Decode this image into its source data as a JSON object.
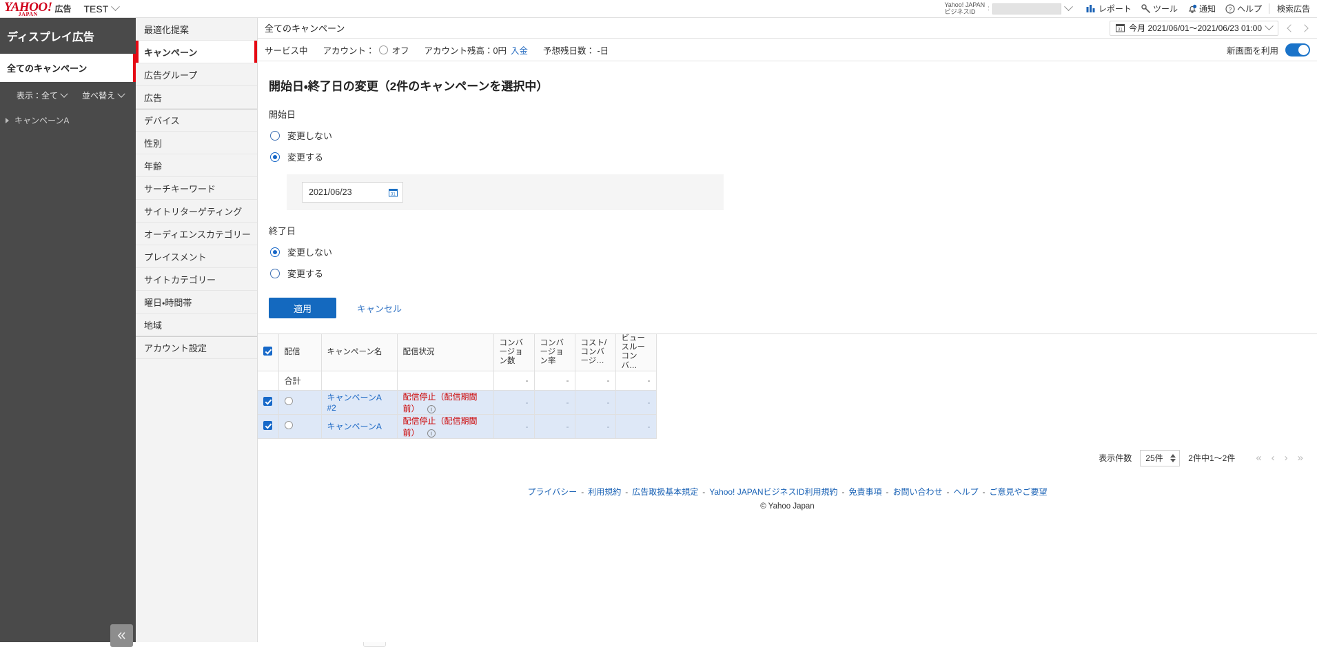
{
  "global_header": {
    "logo_main": "YAHOO!",
    "logo_sub": "JAPAN",
    "logo_suffix": "広告",
    "account_name": "TEST",
    "bizid_label_line1": "Yahoo! JAPAN",
    "bizid_label_line2": "ビジネスID",
    "bizid_colon": ":",
    "bizid_value": "",
    "items": [
      {
        "icon": "report-icon",
        "label": "レポート"
      },
      {
        "icon": "tool-icon",
        "label": "ツール"
      },
      {
        "icon": "bell-icon",
        "label": "通知"
      },
      {
        "icon": "help-icon",
        "label": "ヘルプ"
      }
    ],
    "search_ads_label": "検索広告"
  },
  "left_sidebar": {
    "title": "ディスプレイ広告",
    "active_item": "全てのキャンペーン",
    "filter_display": "表示：全て",
    "filter_sort": "並べ替え",
    "tree": [
      {
        "label": "キャンペーンA"
      }
    ],
    "collapse_icon": "«"
  },
  "menu_sidebar": {
    "items": [
      {
        "label": "最適化提案",
        "active": false,
        "group_start": false
      },
      {
        "label": "キャンペーン",
        "active": true,
        "group_start": false
      },
      {
        "label": "広告グループ",
        "active": false,
        "group_start": false
      },
      {
        "label": "広告",
        "active": false,
        "group_start": false
      },
      {
        "label": "デバイス",
        "active": false,
        "group_start": true
      },
      {
        "label": "性別",
        "active": false,
        "group_start": false
      },
      {
        "label": "年齢",
        "active": false,
        "group_start": false
      },
      {
        "label": "サーチキーワード",
        "active": false,
        "group_start": false
      },
      {
        "label": "サイトリターゲティング",
        "active": false,
        "group_start": false
      },
      {
        "label": "オーディエンスカテゴリー",
        "active": false,
        "group_start": false
      },
      {
        "label": "プレイスメント",
        "active": false,
        "group_start": false
      },
      {
        "label": "サイトカテゴリー",
        "active": false,
        "group_start": false
      },
      {
        "label": "曜日・時間帯",
        "active": false,
        "group_start": false
      },
      {
        "label": "地域",
        "active": false,
        "group_start": false
      },
      {
        "label": "アカウント設定",
        "active": false,
        "group_start": true
      }
    ],
    "collapse_icon": "«"
  },
  "main_header": {
    "title": "全てのキャンペーン",
    "date_range": "今月 2021/06/01〜2021/06/23 01:00",
    "calendar_icon": "calendar-icon"
  },
  "main_subheader": {
    "service_status": "サービス中",
    "account_label": "アカウント：",
    "account_state": "オフ",
    "balance_label": "アカウント残高：0円",
    "deposit_link": "入金",
    "days_left_label": "予想残日数： -日",
    "new_ui_label": "新画面を利用",
    "new_ui_enabled": true
  },
  "form": {
    "title": "開始日・終了日の変更（2件のキャンペーンを選択中）",
    "start_section_label": "開始日",
    "start_options": [
      {
        "label": "変更しない",
        "checked": false
      },
      {
        "label": "変更する",
        "checked": true
      }
    ],
    "start_date_value": "2021/06/23",
    "start_date_icon": "calendar-icon",
    "end_section_label": "終了日",
    "end_options": [
      {
        "label": "変更しない",
        "checked": true
      },
      {
        "label": "変更する",
        "checked": false
      }
    ],
    "apply_label": "適用",
    "cancel_label": "キャンセル"
  },
  "table": {
    "columns": [
      {
        "key": "check",
        "label": ""
      },
      {
        "key": "haishin",
        "label": "配信"
      },
      {
        "key": "name",
        "label": "キャンペーン名"
      },
      {
        "key": "status",
        "label": "配信状況"
      },
      {
        "key": "cv",
        "label": "コンバージョン数"
      },
      {
        "key": "cvr",
        "label": "コンバージョン率"
      },
      {
        "key": "cpa",
        "label": "コスト/コンバージ…"
      },
      {
        "key": "vcv",
        "label": "ビュースルーコンバ…"
      }
    ],
    "header_checked": true,
    "total_row": {
      "label": "合計",
      "cv": "-",
      "cvr": "-",
      "cpa": "-",
      "vcv": "-"
    },
    "rows": [
      {
        "checked": true,
        "name": "キャンペーンA #2",
        "status": "配信停止（配信期間前）",
        "info_icon": "info-icon",
        "cv": "-",
        "cvr": "-",
        "cpa": "-",
        "vcv": "-"
      },
      {
        "checked": true,
        "name": "キャンペーンA",
        "status": "配信停止（配信期間前）",
        "info_icon": "info-icon",
        "cv": "-",
        "cvr": "-",
        "cpa": "-",
        "vcv": "-"
      }
    ]
  },
  "pagination": {
    "rows_label": "表示件数",
    "rows_value": "25件",
    "range_text": "2件中1〜2件",
    "first_icon": "«",
    "prev_icon": "‹",
    "next_icon": "›",
    "last_icon": "»"
  },
  "footer": {
    "links": [
      "プライバシー",
      "利用規約",
      "広告取扱基本規定",
      "Yahoo! JAPANビジネスID利用規約",
      "免責事項",
      "お問い合わせ",
      "ヘルプ",
      "ご意見やご要望"
    ],
    "separator": "-",
    "copyright": "© Yahoo Japan"
  },
  "colors": {
    "brand_red": "#d0011b",
    "accent_blue": "#1469bf",
    "link_blue": "#1a67c4",
    "status_red": "#cc0000",
    "sidebar_dark": "#4a4a4a"
  }
}
